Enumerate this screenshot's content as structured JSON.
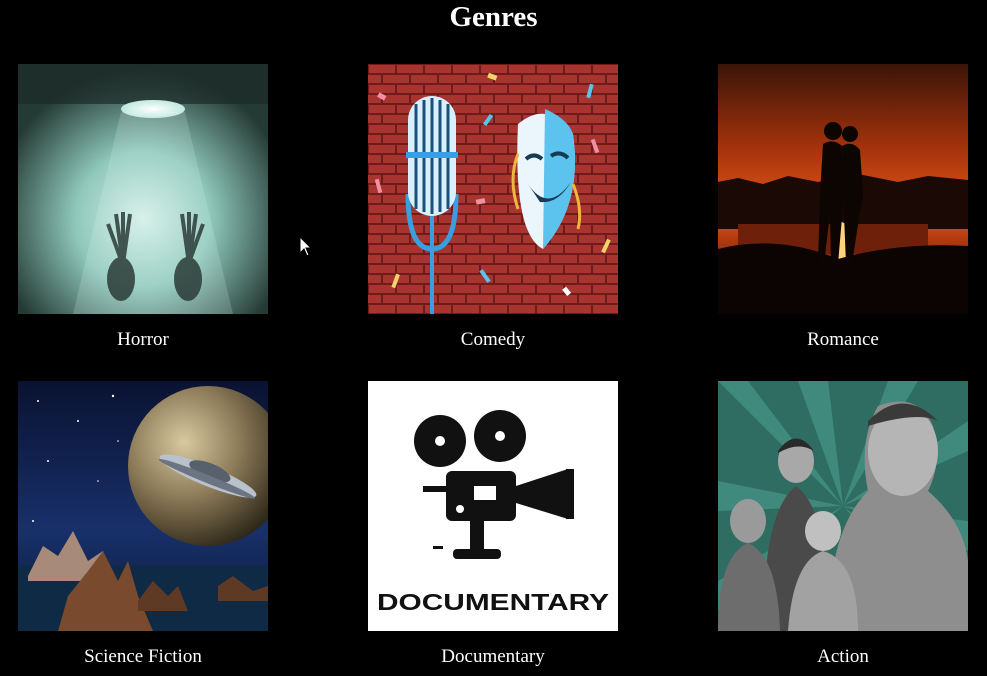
{
  "page": {
    "title": "Genres"
  },
  "genres": [
    {
      "label": "Horror"
    },
    {
      "label": "Comedy"
    },
    {
      "label": "Romance"
    },
    {
      "label": "Science Fiction"
    },
    {
      "label": "Documentary",
      "poster_text": "DOCUMENTARY"
    },
    {
      "label": "Action"
    }
  ]
}
